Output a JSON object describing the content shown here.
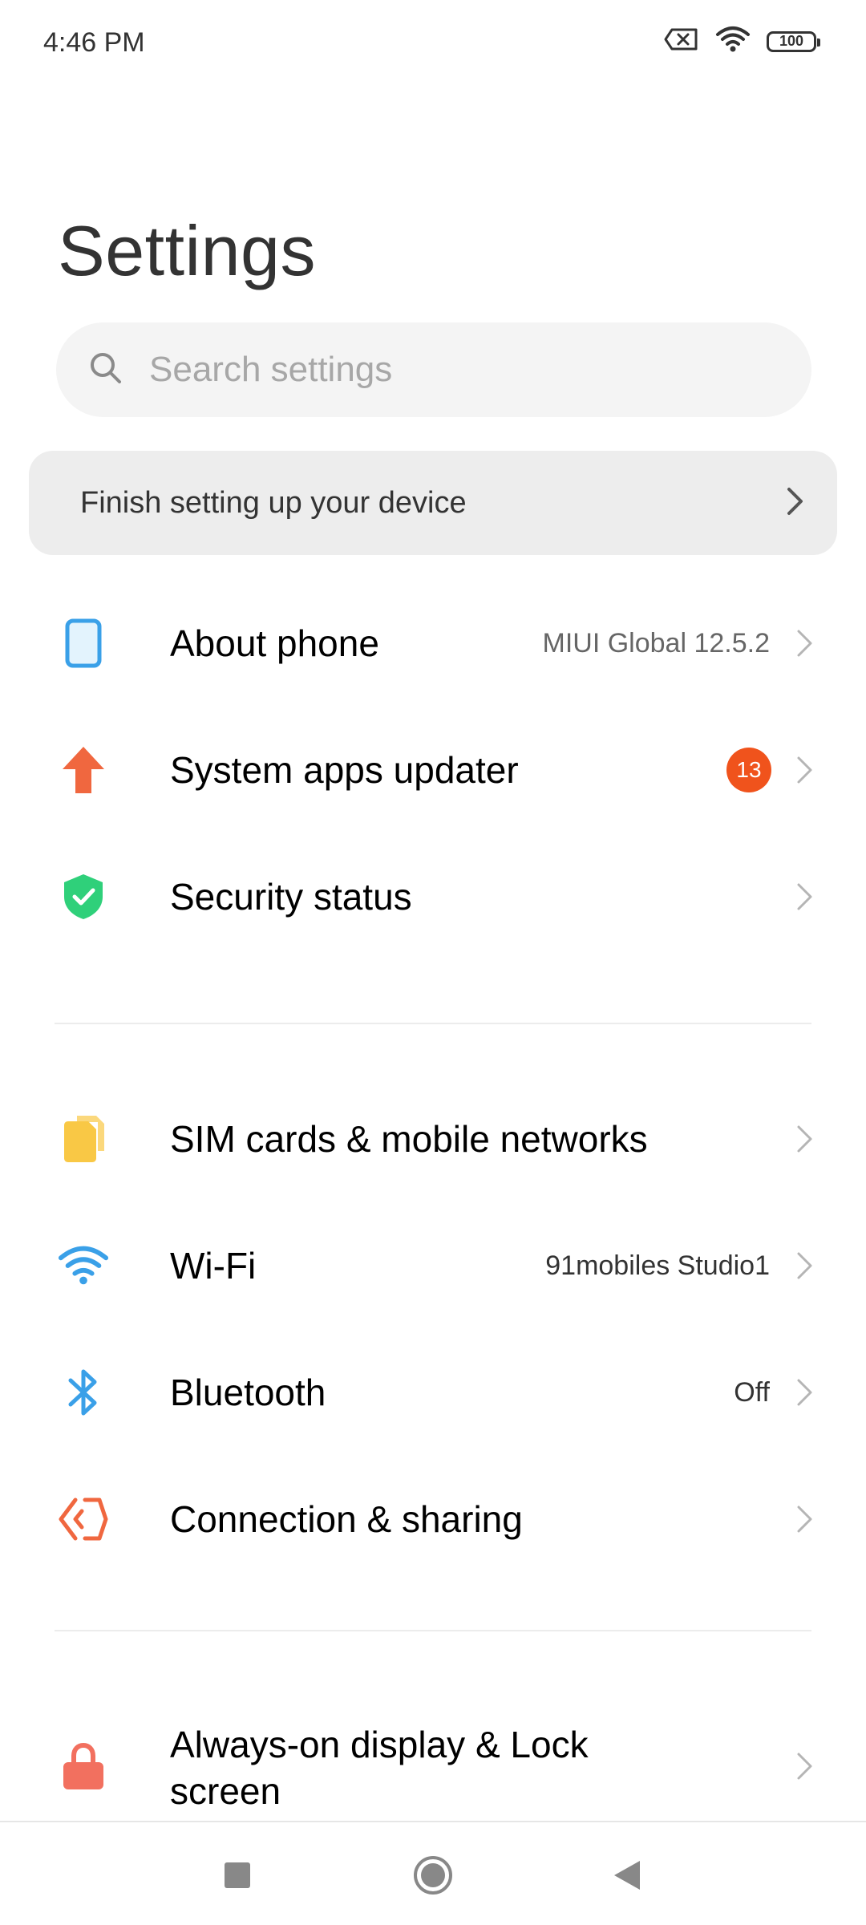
{
  "status_bar": {
    "time": "4:46 PM",
    "battery": "100"
  },
  "header": {
    "title": "Settings"
  },
  "search": {
    "placeholder": "Search settings"
  },
  "setup_card": {
    "label": "Finish setting up your device"
  },
  "items": [
    {
      "label": "About phone",
      "value": "MIUI Global 12.5.2"
    },
    {
      "label": "System apps updater",
      "badge": "13"
    },
    {
      "label": "Security status"
    },
    {
      "label": "SIM cards & mobile networks"
    },
    {
      "label": "Wi-Fi",
      "value": "91mobiles Studio1"
    },
    {
      "label": "Bluetooth",
      "value": "Off"
    },
    {
      "label": "Connection & sharing"
    },
    {
      "label": "Always-on display & Lock screen"
    }
  ],
  "colors": {
    "accent_blue": "#3aa0e8",
    "updater_orange": "#f0673f",
    "security_green": "#2fd07a",
    "sim_yellow": "#f9c845",
    "badge_orange": "#f0531c",
    "lock_red": "#f2705f"
  },
  "icons": {
    "about": "phone-icon",
    "updater": "arrow-up-icon",
    "security": "shield-check-icon",
    "sim": "sim-card-icon",
    "wifi": "wifi-icon",
    "bluetooth": "bluetooth-icon",
    "connection": "share-connection-icon",
    "lock": "lock-icon"
  }
}
